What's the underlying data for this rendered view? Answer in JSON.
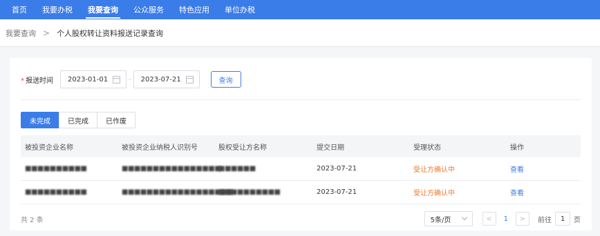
{
  "nav": {
    "items": [
      {
        "label": "首页",
        "active": false
      },
      {
        "label": "我要办税",
        "active": false
      },
      {
        "label": "我要查询",
        "active": true
      },
      {
        "label": "公众服务",
        "active": false
      },
      {
        "label": "特色应用",
        "active": false
      },
      {
        "label": "单位办税",
        "active": false
      }
    ]
  },
  "breadcrumb": {
    "parent": "我要查询",
    "separator": ">",
    "current": "个人股权转让资料报送记录查询"
  },
  "filter": {
    "required_mark": "*",
    "label": "报送时间",
    "start_date": "2023-01-01",
    "range_separator": "-",
    "end_date": "2023-07-21",
    "query_label": "查询"
  },
  "tabs": [
    {
      "label": "未完成",
      "active": true
    },
    {
      "label": "已完成",
      "active": false
    },
    {
      "label": "已作废",
      "active": false
    }
  ],
  "table": {
    "columns": [
      "被投资企业名称",
      "被投资企业纳税人识别号",
      "股权受让方名称",
      "提交日期",
      "受理状态",
      "操作"
    ],
    "rows": [
      {
        "company_name": "■■■■■■■■■■",
        "tax_id": "■■■■■■■■■■■■■■■■",
        "transferee": "■■■■■■",
        "date": "2023-07-21",
        "status": "受让方确认中",
        "action": "查看"
      },
      {
        "company_name": "■■■■■■■■■■",
        "tax_id": "■■■■■■■■■■■■■■■■■■",
        "transferee": "■■■■■■■■■■",
        "date": "2023-07-21",
        "status": "受让方确认中",
        "action": "查看"
      }
    ]
  },
  "pagination": {
    "total_text": "共 2 条",
    "page_size": "5条/页",
    "prev": "<",
    "current_page": "1",
    "next": ">",
    "goto_label": "前往",
    "goto_value": "1",
    "goto_suffix": "页"
  },
  "colors": {
    "primary": "#3a7ce8",
    "status_pending": "#f07a28",
    "required": "#e34b4b"
  }
}
